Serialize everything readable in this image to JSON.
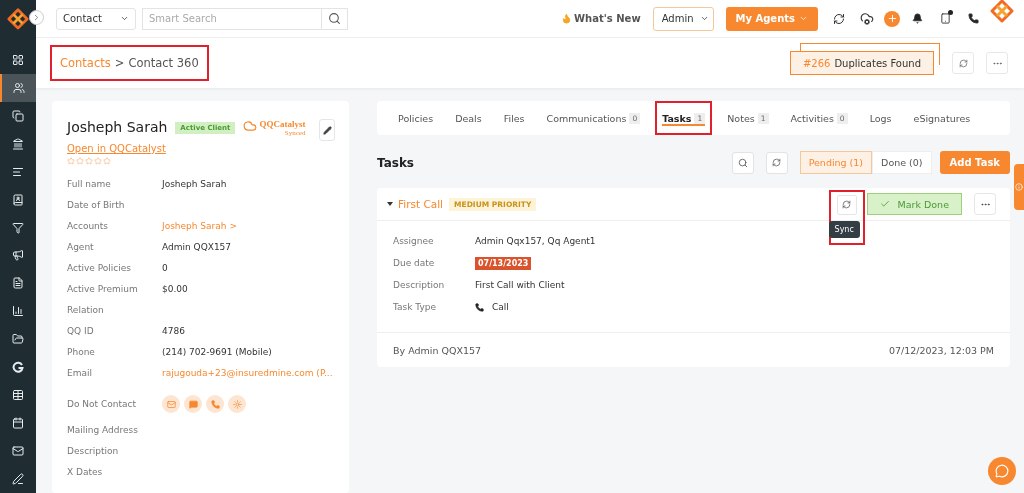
{
  "topbar": {
    "module_select": "Contact",
    "search_placeholder": "Smart Search",
    "whats_new": "What's New",
    "role_select": "Admin",
    "agents_button": "My Agents"
  },
  "sidebar": {
    "items": [
      {
        "selected": false
      },
      {
        "selected": true
      },
      {
        "selected": false
      },
      {
        "selected": false
      },
      {
        "selected": false
      },
      {
        "selected": false
      },
      {
        "selected": false
      },
      {
        "selected": false
      },
      {
        "selected": false
      },
      {
        "selected": false
      },
      {
        "selected": false
      },
      {
        "selected": false
      },
      {
        "selected": false
      },
      {
        "selected": false
      },
      {
        "selected": false
      },
      {
        "selected": false
      }
    ]
  },
  "breadcrumb": {
    "parent": "Contacts",
    "separator": ">",
    "current": "Contact 360",
    "highlighted": true
  },
  "duplicates": {
    "count": "#266",
    "label": "Duplicates Found"
  },
  "contact": {
    "name": "Josheph Sarah",
    "status": "Active Client",
    "sync_brand": "QQCatalyst",
    "sync_status": "Synced",
    "open_link": "Open in QQCatalyst",
    "stars": 0,
    "fields": [
      {
        "label": "Full name",
        "value": "Josheph Sarah",
        "kind": "text"
      },
      {
        "label": "Date of Birth",
        "kind": "text"
      },
      {
        "label": "Accounts",
        "value": "Josheph Sarah >",
        "kind": "link"
      },
      {
        "label": "Agent",
        "value": "Admin QQX157",
        "kind": "text"
      },
      {
        "label": "Active Policies",
        "value": "0",
        "kind": "text"
      },
      {
        "label": "Active Premium",
        "value": "$0.00",
        "kind": "text"
      },
      {
        "label": "Relation",
        "kind": "text"
      },
      {
        "label": "QQ ID",
        "value": "4786",
        "kind": "text"
      },
      {
        "label": "Phone",
        "value": "(214) 702-9691 (Mobile)",
        "kind": "text"
      },
      {
        "label": "Email",
        "value": "rajugouda+23@insuredmine.com  (P...",
        "kind": "link"
      },
      {
        "label": "Do Not Contact",
        "kind": "channels"
      },
      {
        "label": "Mailing Address",
        "kind": "text"
      },
      {
        "label": "Description",
        "kind": "text"
      },
      {
        "label": "X Dates",
        "kind": "text"
      }
    ]
  },
  "tabs": [
    {
      "label": "Policies",
      "selected": false
    },
    {
      "label": "Deals",
      "selected": false
    },
    {
      "label": "Files",
      "selected": false
    },
    {
      "label": "Communications",
      "count": "0",
      "selected": false
    },
    {
      "label": "Tasks",
      "count": "1",
      "selected": true,
      "highlighted": true
    },
    {
      "label": "Notes",
      "count": "1",
      "selected": false
    },
    {
      "label": "Activities",
      "count": "0",
      "selected": false
    },
    {
      "label": "Logs",
      "selected": false
    },
    {
      "label": "eSignatures",
      "selected": false
    }
  ],
  "tasks": {
    "title": "Tasks",
    "filters": [
      {
        "label": "Pending (1)",
        "selected": true
      },
      {
        "label": "Done (0)",
        "selected": false
      }
    ],
    "add_button": "Add Task",
    "items": [
      {
        "title": "First Call",
        "priority": "MEDIUM PRIORITY",
        "expanded": true,
        "sync_highlighted": true,
        "tooltip": "Sync",
        "mark_done": "Mark Done",
        "details": [
          {
            "label": "Assignee",
            "value": "Admin Qqx157, Qq Agent1",
            "kind": "text"
          },
          {
            "label": "Due date",
            "value": "07/13/2023",
            "kind": "date"
          },
          {
            "label": "Description",
            "value": "First Call with Client",
            "kind": "text"
          },
          {
            "label": "Task Type",
            "value": "Call",
            "kind": "call"
          }
        ],
        "author": "By Admin QQX157",
        "timestamp": "07/12/2023, 12:03 PM"
      }
    ]
  }
}
